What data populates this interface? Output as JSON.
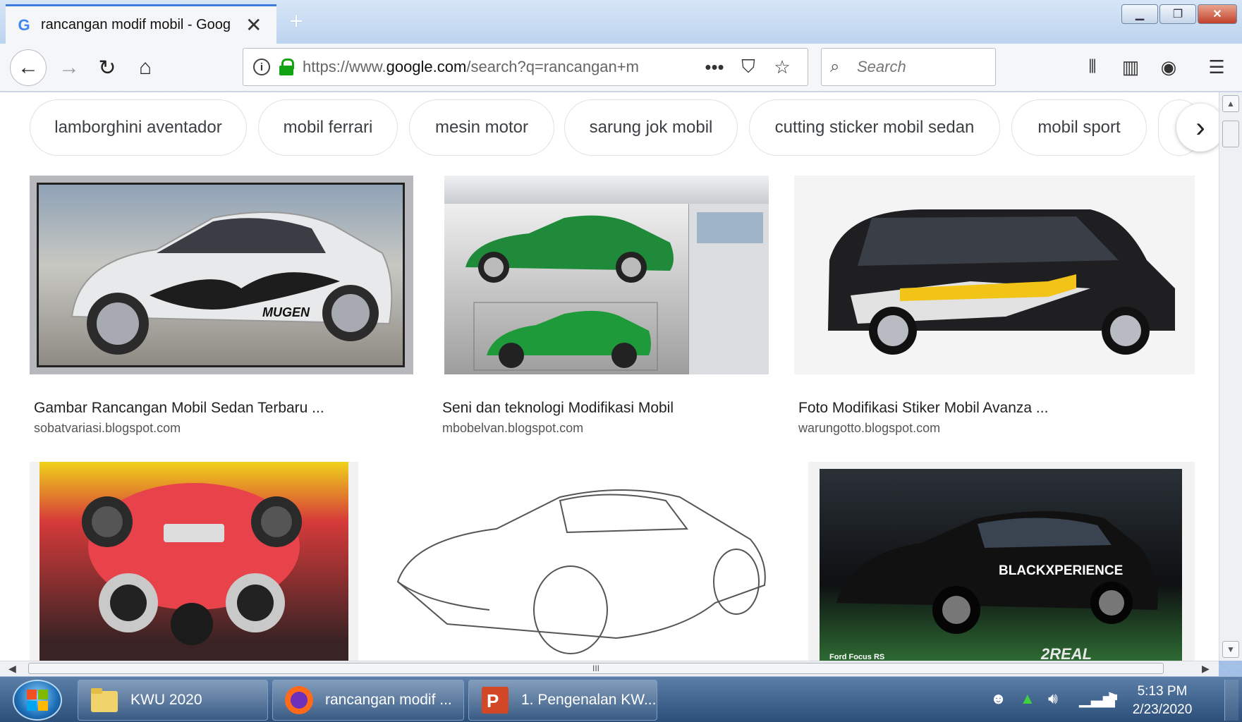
{
  "browser": {
    "tab_title": "rancangan modif mobil - Goog",
    "url_prefix": "https://www.",
    "url_domain": "google.com",
    "url_path": "/search?q=rancangan+m",
    "search_placeholder": "Search"
  },
  "chips": [
    "lamborghini aventador",
    "mobil ferrari",
    "mesin motor",
    "sarung jok mobil",
    "cutting sticker mobil sedan",
    "mobil sport"
  ],
  "results": [
    {
      "title": "Gambar Rancangan Mobil Sedan Terbaru ...",
      "source": "sobatvariasi.blogspot.com",
      "overlay": "MUGEN"
    },
    {
      "title": "Seni dan teknologi Modifikasi Mobil",
      "source": "mbobelvan.blogspot.com"
    },
    {
      "title": "Foto Modifikasi Stiker Mobil Avanza ...",
      "source": "warungotto.blogspot.com"
    },
    {
      "title": "",
      "source": ""
    },
    {
      "title": "",
      "source": ""
    },
    {
      "title": "",
      "source": "",
      "overlay": "BLACKXPERIENCE",
      "overlay2": "Ford Focus RS",
      "overlay3": "2REAL"
    }
  ],
  "scrollbar": {
    "hgrip": "III"
  },
  "taskbar": {
    "items": [
      {
        "label": "KWU 2020",
        "icon": "folder-icon"
      },
      {
        "label": "rancangan modif ...",
        "icon": "firefox-icon"
      },
      {
        "label": "1. Pengenalan KW...",
        "icon": "powerpoint-icon"
      }
    ],
    "time": "5:13 PM",
    "date": "2/23/2020"
  },
  "colors": {
    "accent": "#3b7ddd",
    "lock": "#12a312",
    "taskbar": "#2c4f7a"
  }
}
